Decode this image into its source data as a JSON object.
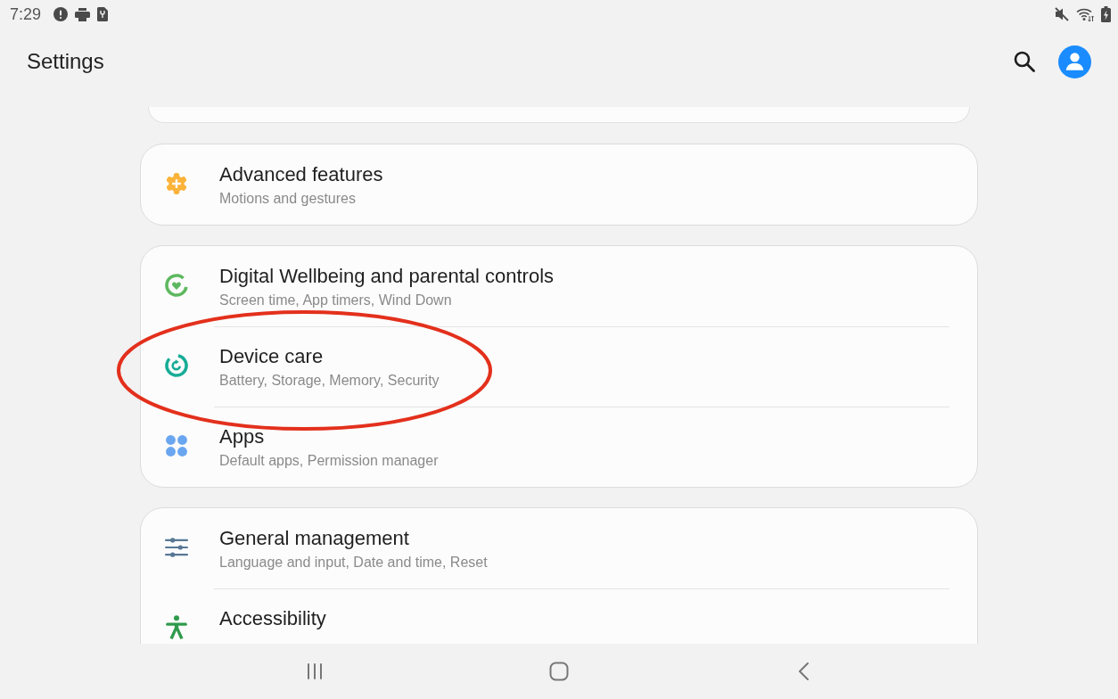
{
  "status_bar": {
    "time": "7:29"
  },
  "header": {
    "title": "Settings"
  },
  "groups": [
    {
      "items": [
        {
          "kind": "advanced",
          "title": "Advanced features",
          "subtitle": "Motions and gestures",
          "highlighted": false
        }
      ]
    },
    {
      "items": [
        {
          "kind": "wellbeing",
          "title": "Digital Wellbeing and parental controls",
          "subtitle": "Screen time, App timers, Wind Down",
          "highlighted": false
        },
        {
          "kind": "care",
          "title": "Device care",
          "subtitle": "Battery, Storage, Memory, Security",
          "highlighted": true
        },
        {
          "kind": "apps",
          "title": "Apps",
          "subtitle": "Default apps, Permission manager",
          "highlighted": false
        }
      ]
    },
    {
      "items": [
        {
          "kind": "general",
          "title": "General management",
          "subtitle": "Language and input, Date and time, Reset",
          "highlighted": false
        },
        {
          "kind": "accessibility",
          "title": "Accessibility",
          "highlighted": false
        }
      ]
    }
  ]
}
